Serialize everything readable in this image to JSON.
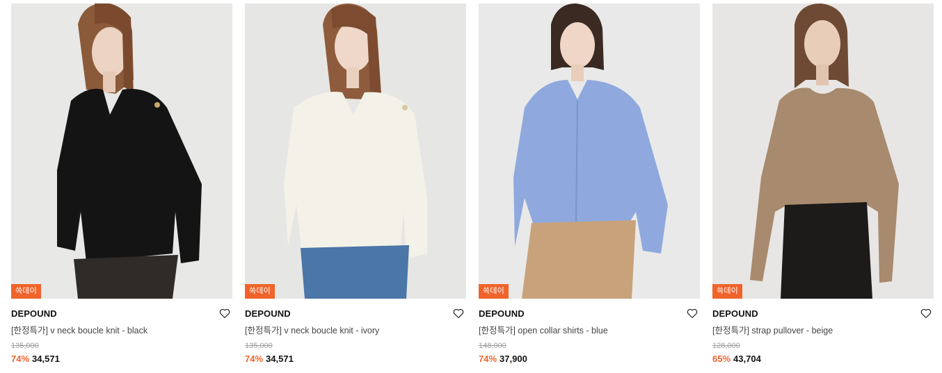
{
  "colors": {
    "accent": "#f0632b",
    "badge_bg": "#f0632b",
    "original_price": "#9c9c9c"
  },
  "products": [
    {
      "badge": "쓱데이",
      "brand": "DEPOUND",
      "name": "[한정특가] v neck boucle knit - black",
      "original_price": "135,000",
      "discount_rate": "74%",
      "sale_price": "34,571"
    },
    {
      "badge": "쓱데이",
      "brand": "DEPOUND",
      "name": "[한정특가] v neck boucle knit - ivory",
      "original_price": "135,000",
      "discount_rate": "74%",
      "sale_price": "34,571"
    },
    {
      "badge": "쓱데이",
      "brand": "DEPOUND",
      "name": "[한정특가] open collar shirts - blue",
      "original_price": "148,000",
      "discount_rate": "74%",
      "sale_price": "37,900"
    },
    {
      "badge": "쓱데이",
      "brand": "DEPOUND",
      "name": "[한정특가] strap pullover - beige",
      "original_price": "128,000",
      "discount_rate": "65%",
      "sale_price": "43,704"
    }
  ]
}
